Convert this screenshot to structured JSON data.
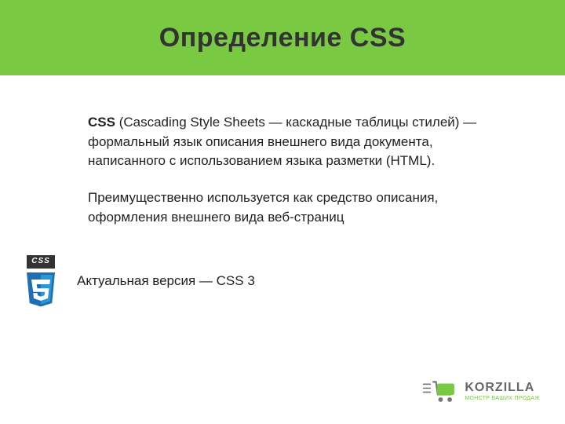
{
  "header": {
    "title": "Определение CSS"
  },
  "body": {
    "p1_bold": "CSS",
    "p1_rest": " (Cascading Style Sheets — каскадные таблицы стилей) — формальный язык описания внешнего вида документа, написанного с использованием языка разметки (HTML).",
    "p2": "Преимущественно используется как средство описания, оформления внешнего вида веб-страниц",
    "version_text": "Актуальная версия  —  CSS 3",
    "css3_badge_label": "CSS"
  },
  "footer": {
    "brand": "KORZILLA",
    "tagline": "МОНСТР ВАШИХ ПРОДАЖ"
  }
}
